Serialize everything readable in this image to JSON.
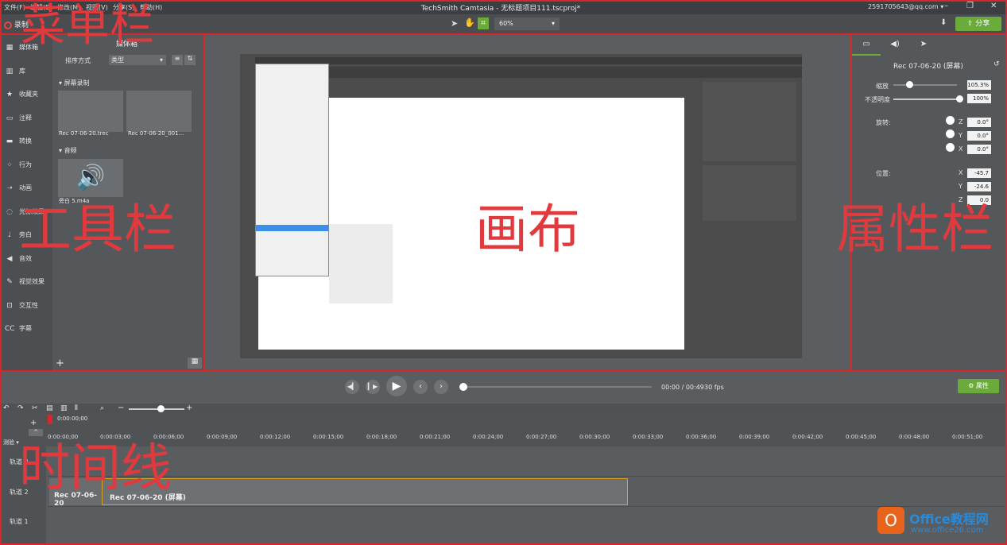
{
  "menu": [
    "文件(F)",
    "编辑(E)",
    "修改(M)",
    "视图(V)",
    "分享(S)",
    "帮助(H)"
  ],
  "app_title": "TechSmith Camtasia - 无标题项目111.tscproj*",
  "account": "2591705643@qq.com ▾",
  "toolbar": {
    "record_label": "录制",
    "zoom": "60%",
    "share_label": "分享"
  },
  "rail": [
    "媒体箱",
    "库",
    "收藏夹",
    "注释",
    "转换",
    "行为",
    "动画",
    "光标效果",
    "旁白",
    "音效",
    "视觉效果",
    "交互性",
    "字幕"
  ],
  "rail_icons": [
    "film-icon",
    "library-icon",
    "star-icon",
    "callout-icon",
    "transition-icon",
    "behavior-icon",
    "animation-icon",
    "cursor-icon",
    "mic-icon",
    "audio-icon",
    "visual-effect-icon",
    "interactive-icon",
    "caption-icon"
  ],
  "media": {
    "tab": "媒体箱",
    "sort_label": "排序方式",
    "sort_value": "类型",
    "section_screen": "屏幕录制",
    "clip1": "Rec 07-06-20.trec",
    "clip2": "Rec 07-06-20_001...",
    "section_audio": "音频",
    "audio1": "旁白 5.m4a"
  },
  "props": {
    "title": "Rec 07-06-20 (屏幕)",
    "scale_label": "缩放",
    "scale_value": "105.3%",
    "opacity_label": "不透明度",
    "opacity_value": "100%",
    "rotate_label": "旋转:",
    "rot_z": "0.0°",
    "rot_y": "0.0°",
    "rot_x": "0.0°",
    "pos_label": "位置:",
    "pos_x": "-45.7",
    "pos_y": "-24.6",
    "pos_z": "0.0",
    "z": "Z",
    "y": "Y",
    "x": "X"
  },
  "playback": {
    "time": "00:00 / 00:49",
    "fps": "30 fps",
    "props_btn": "属性"
  },
  "ruler": [
    "0:00:00;00",
    "0:00:03;00",
    "0:00:06;00",
    "0:00:09;00",
    "0:00:12;00",
    "0:00:15;00",
    "0:00:18;00",
    "0:00:21;00",
    "0:00:24;00",
    "0:00:27;00",
    "0:00:30;00",
    "0:00:33;00",
    "0:00:36;00",
    "0:00:39;00",
    "0:00:42;00",
    "0:00:45;00",
    "0:00:48;00",
    "0:00:51;00"
  ],
  "playhead_time": "0:00:00;00",
  "tracks": [
    "轨道 3",
    "轨道 2",
    "轨道 1"
  ],
  "clips": {
    "c1": "Rec 07-06-20",
    "c2": "Rec 07-06-20 (屏幕)"
  },
  "annotations": {
    "menubar": "菜单栏",
    "toolbar": "工具栏",
    "canvas": "画布",
    "props": "属性栏",
    "timeline": "时间线"
  },
  "watermark": {
    "brand": "Office教程网",
    "url": "www.office26.com"
  },
  "colors": {
    "accent_green": "#6bab3b",
    "annotation_red": "#d8262d",
    "record_red": "#e84545"
  }
}
